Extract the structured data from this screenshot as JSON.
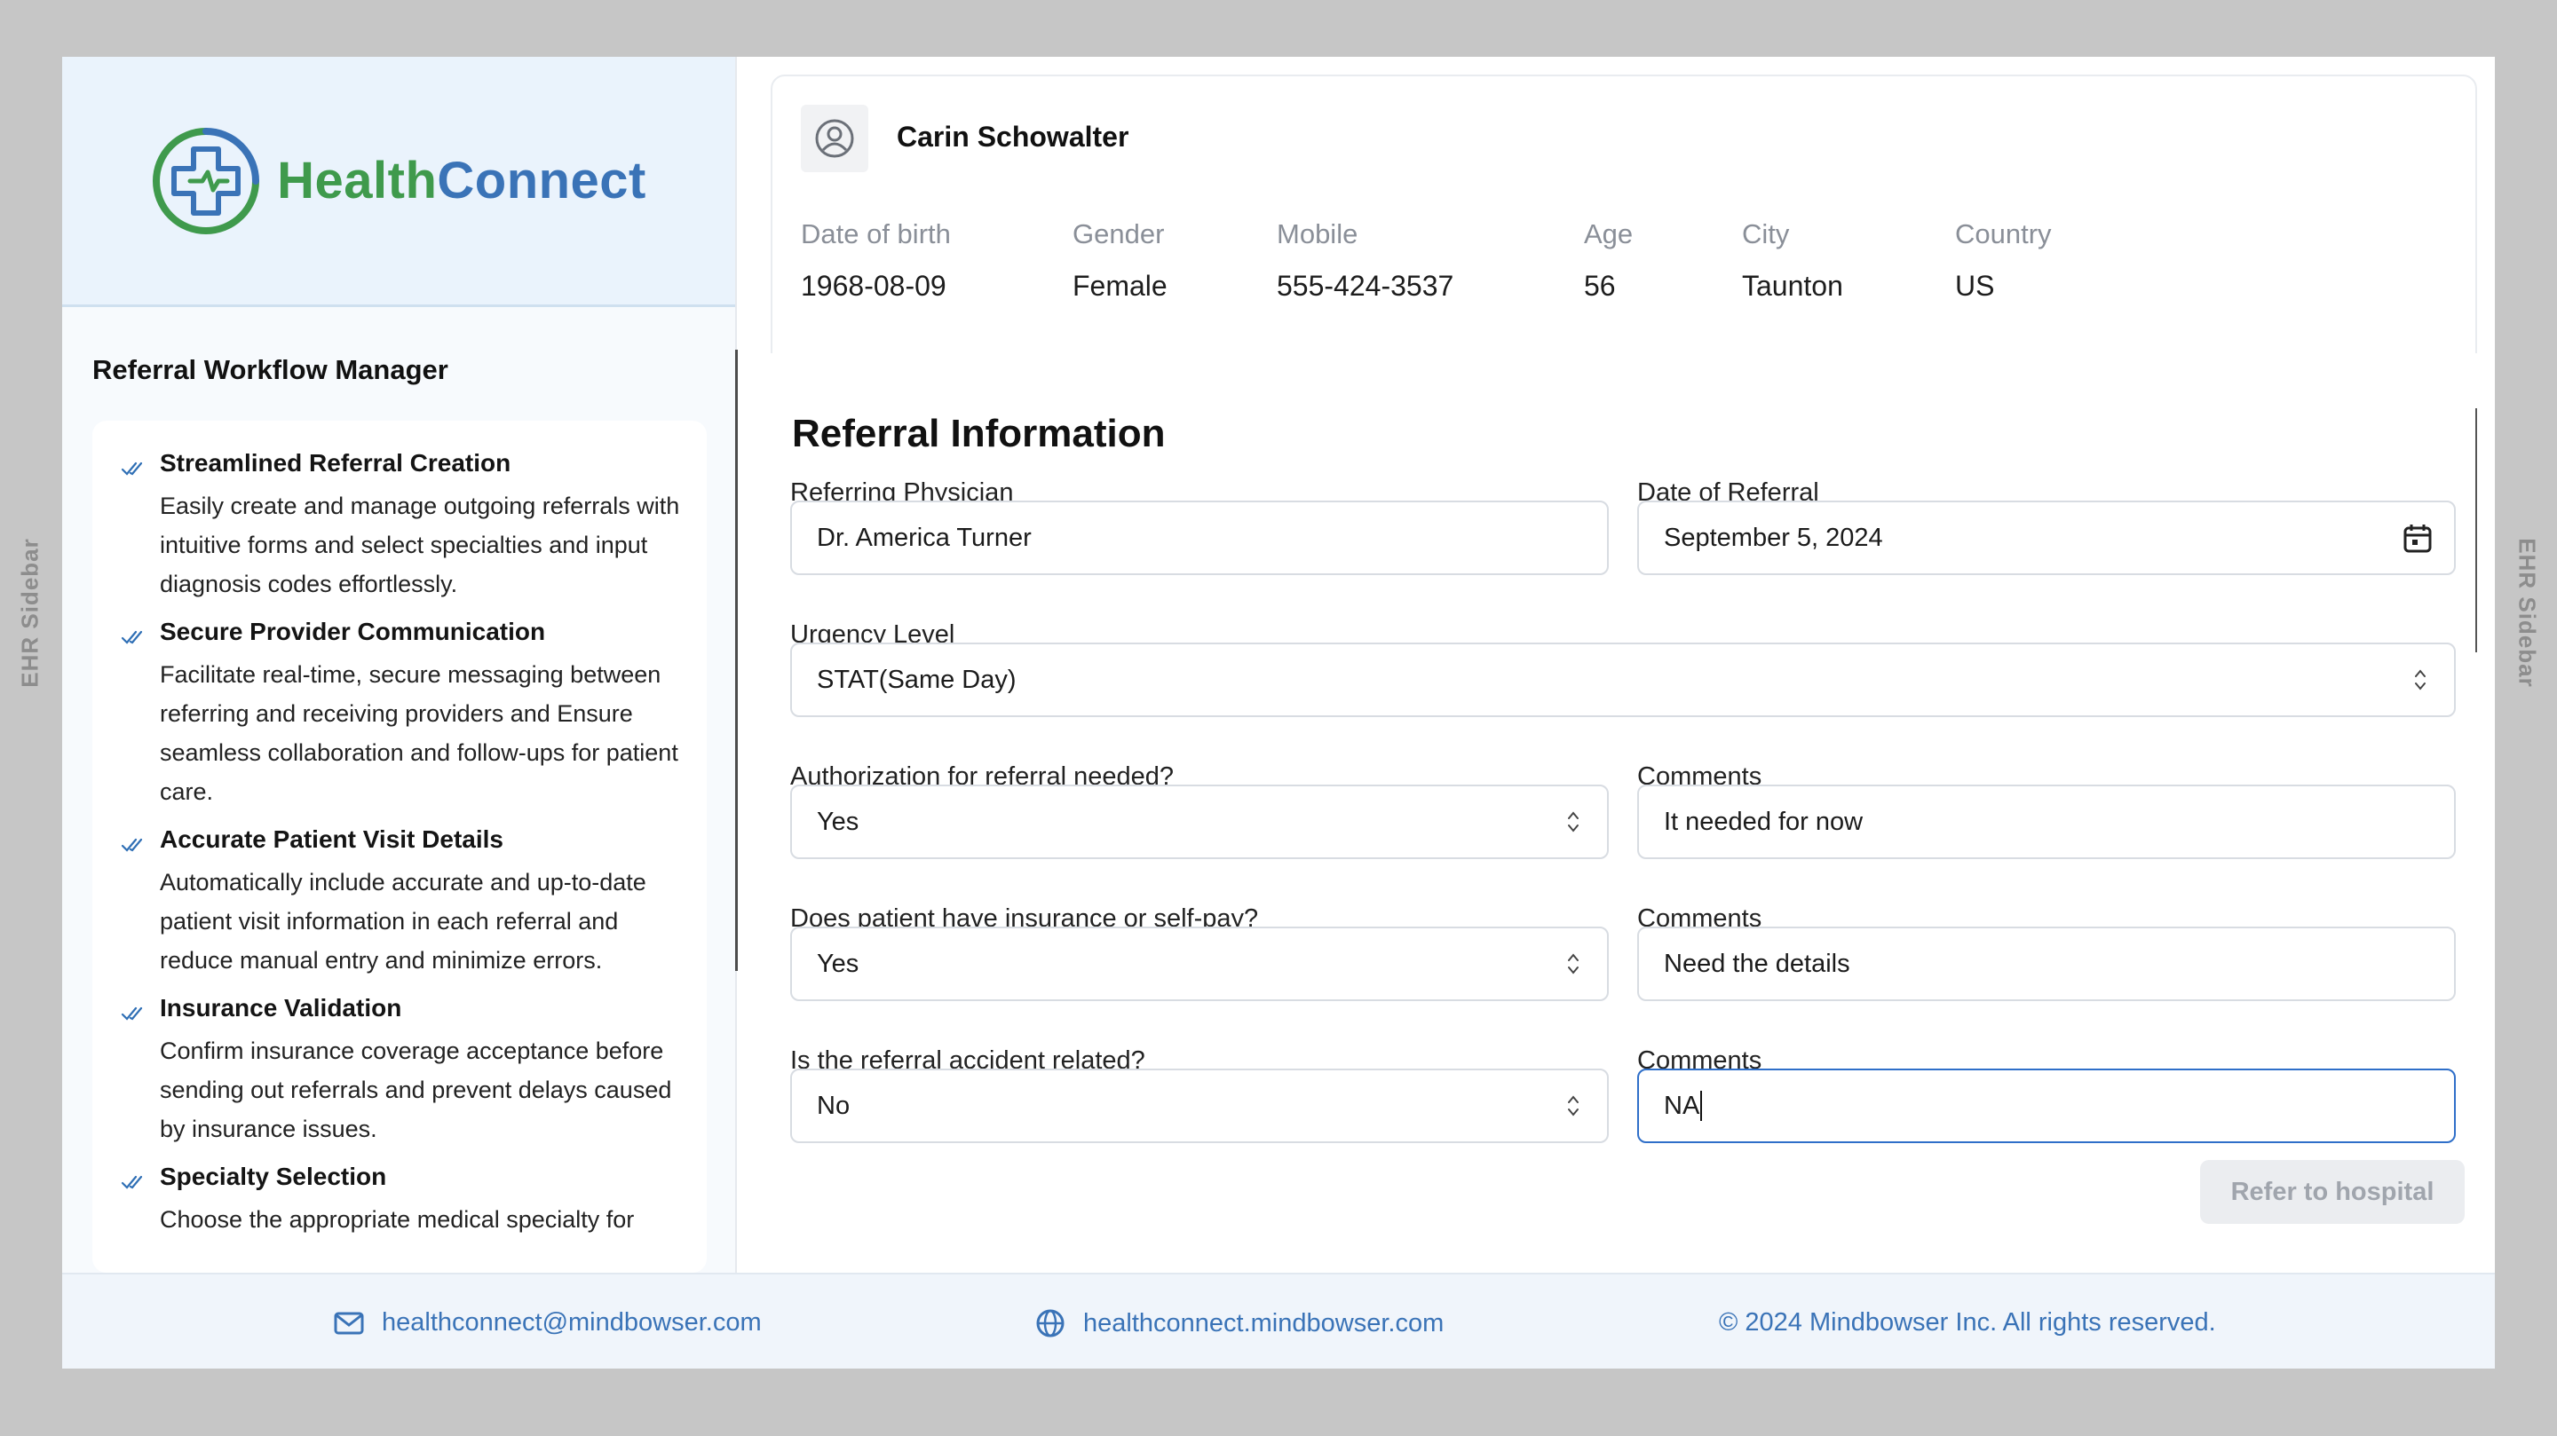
{
  "ehr_sidebar_label": "EHR Sidebar",
  "brand": {
    "name_part1": "Health",
    "name_part2": "Connect"
  },
  "sidebar": {
    "title": "Referral Workflow Manager",
    "features": [
      {
        "title": "Streamlined Referral Creation",
        "desc": "Easily create and manage outgoing referrals with intuitive forms and select specialties and input diagnosis codes effortlessly."
      },
      {
        "title": "Secure Provider Communication",
        "desc": "Facilitate real-time, secure messaging between referring and receiving providers and Ensure seamless collaboration and follow-ups for patient care."
      },
      {
        "title": "Accurate Patient Visit Details",
        "desc": "Automatically include accurate and up-to-date patient visit information in each referral and reduce manual entry and minimize errors."
      },
      {
        "title": "Insurance Validation",
        "desc": "Confirm insurance coverage acceptance before sending out referrals and prevent delays caused by insurance issues."
      },
      {
        "title": "Specialty Selection",
        "desc": "Choose the appropriate medical specialty for"
      }
    ]
  },
  "patient": {
    "name": "Carin Schowalter",
    "fields": [
      {
        "label": "Date of birth",
        "value": "1968-08-09"
      },
      {
        "label": "Gender",
        "value": "Female"
      },
      {
        "label": "Mobile",
        "value": "555-424-3537"
      },
      {
        "label": "Age",
        "value": "56"
      },
      {
        "label": "City",
        "value": "Taunton"
      },
      {
        "label": "Country",
        "value": "US"
      }
    ]
  },
  "referral": {
    "title": "Referral Information",
    "physician_label": "Referring Physician",
    "physician_value": "Dr. America Turner",
    "date_label": "Date of Referral",
    "date_value": "September 5, 2024",
    "urgency_label": "Urgency Level",
    "urgency_value": "STAT(Same Day)",
    "auth_label": "Authorization for referral needed?",
    "auth_value": "Yes",
    "auth_comment_label": "Comments",
    "auth_comment_value": "It needed for now",
    "insurance_label": "Does patient have insurance or self-pay?",
    "insurance_value": "Yes",
    "insurance_comment_label": "Comments",
    "insurance_comment_value": "Need the details",
    "accident_label": "Is the referral accident related?",
    "accident_value": "No",
    "accident_comment_label": "Comments",
    "accident_comment_value": "NA",
    "submit_label": "Refer to hospital"
  },
  "footer": {
    "email": "healthconnect@mindbowser.com",
    "website": "healthconnect.mindbowser.com",
    "copyright": "© 2024 Mindbowser Inc. All rights reserved."
  },
  "colors": {
    "brand_green": "#3f9a4c",
    "brand_blue": "#3a73b7",
    "focus_blue": "#2f6fc9"
  }
}
